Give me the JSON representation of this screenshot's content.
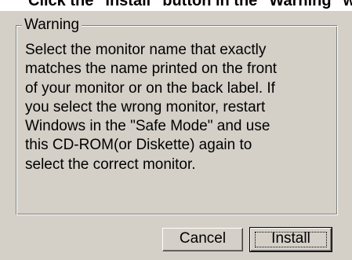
{
  "instruction_strip": {
    "text": "Click the \"Install\" button in the \"Warning\" wi..."
  },
  "warning_group": {
    "title": "Warning",
    "lines": [
      "Select the monitor name that exactly",
      "matches the name printed on the front",
      "of your monitor or on the back label. If",
      "you select the wrong monitor, restart",
      "Windows in the \"Safe Mode\" and use",
      "this CD-ROM(or Diskette) again to",
      "select the correct monitor."
    ]
  },
  "buttons": {
    "cancel_label": "Cancel",
    "install_label": "Install"
  }
}
